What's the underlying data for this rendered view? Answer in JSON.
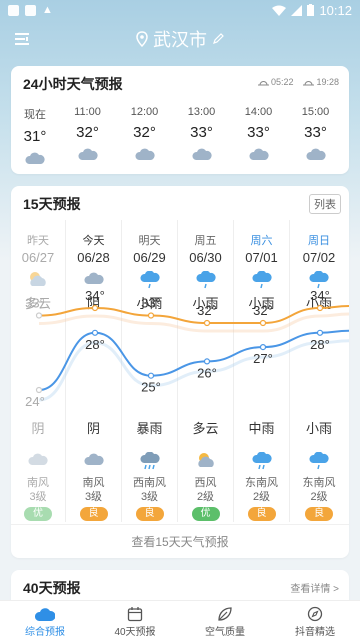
{
  "status_bar": {
    "time": "10:12"
  },
  "header": {
    "city": "武汉市"
  },
  "hourly_card": {
    "title": "24小时天气预报",
    "sunrise": "05:22",
    "sunset": "19:28",
    "hours": [
      {
        "time": "现在",
        "temp": "31°"
      },
      {
        "time": "11:00",
        "temp": "32°"
      },
      {
        "time": "12:00",
        "temp": "32°"
      },
      {
        "time": "13:00",
        "temp": "33°"
      },
      {
        "time": "14:00",
        "temp": "33°"
      },
      {
        "time": "15:00",
        "temp": "33°"
      }
    ]
  },
  "forecast15": {
    "title": "15天预报",
    "list_label": "列表",
    "view_all": "查看15天天气预报",
    "days": [
      {
        "name": "昨天",
        "date": "06/27",
        "day_cond": "多云",
        "high": "33°",
        "low": "24°",
        "night_cond": "阴",
        "wind_dir": "南风",
        "wind_level": "3级",
        "aqi": "优"
      },
      {
        "name": "今天",
        "date": "06/28",
        "day_cond": "阴",
        "high": "34°",
        "low": "28°",
        "night_cond": "阴",
        "wind_dir": "南风",
        "wind_level": "3级",
        "aqi": "良"
      },
      {
        "name": "明天",
        "date": "06/29",
        "day_cond": "小雨",
        "high": "33°",
        "low": "25°",
        "night_cond": "暴雨",
        "wind_dir": "西南风",
        "wind_level": "3级",
        "aqi": "良"
      },
      {
        "name": "周五",
        "date": "06/30",
        "day_cond": "小雨",
        "high": "32°",
        "low": "26°",
        "night_cond": "多云",
        "wind_dir": "西风",
        "wind_level": "2级",
        "aqi": "优"
      },
      {
        "name": "周六",
        "date": "07/01",
        "day_cond": "小雨",
        "high": "32°",
        "low": "27°",
        "night_cond": "中雨",
        "wind_dir": "东南风",
        "wind_level": "2级",
        "aqi": "良"
      },
      {
        "name": "周日",
        "date": "07/02",
        "day_cond": "小雨",
        "high": "34°",
        "low": "28°",
        "night_cond": "小雨",
        "wind_dir": "东南风",
        "wind_level": "2级",
        "aqi": "良"
      }
    ]
  },
  "forecast40": {
    "title": "40天预报",
    "detail": "查看详情 >"
  },
  "bottom_nav": [
    {
      "label": "综合预报"
    },
    {
      "label": "40天预报"
    },
    {
      "label": "空气质量"
    },
    {
      "label": "抖音精选"
    }
  ],
  "colors": {
    "accent": "#2f8fe6",
    "high_line": "#f3a53a",
    "low_line": "#4a96e6",
    "aqi_good": "#5cbf6a",
    "aqi_moderate": "#f3a63b"
  }
}
